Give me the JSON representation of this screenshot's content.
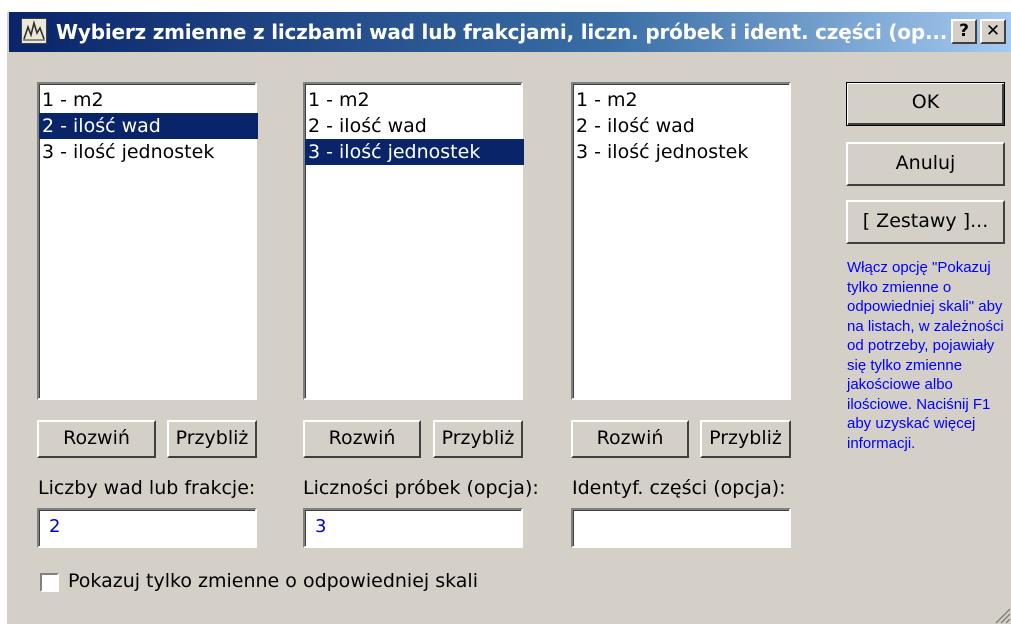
{
  "window": {
    "title": "Wybierz zmienne z liczbami wad lub frakcjami, liczn. próbek i ident. części (op...",
    "help_glyph": "?",
    "close_glyph": "✕"
  },
  "lists": [
    {
      "items": [
        "1 - m2",
        "2 - ilość wad",
        "3 - ilość jednostek"
      ],
      "selected": 1
    },
    {
      "items": [
        "1 - m2",
        "2 - ilość wad",
        "3 - ilość jednostek"
      ],
      "selected": 2
    },
    {
      "items": [
        "1 - m2",
        "2 - ilość wad",
        "3 - ilość jednostek"
      ],
      "selected": -1
    }
  ],
  "list_buttons": {
    "expand": "Rozwiń",
    "zoom": "Przybliż"
  },
  "fields": [
    {
      "label": "Liczby wad lub frakcje:",
      "value": "2"
    },
    {
      "label": "Liczności próbek (opcja):",
      "value": "3"
    },
    {
      "label": "Identyf. części (opcja):",
      "value": ""
    }
  ],
  "actions": {
    "ok": "OK",
    "cancel": "Anuluj",
    "sets": "[ Zestawy ]..."
  },
  "hint": "Włącz opcję \"Pokazuj tylko zmienne o odpowiedniej skali\" aby na listach, w zależności od potrzeby, pojawiały się tylko zmienne jakościowe albo ilościowe. Naciśnij F1 aby uzyskać więcej informacji.",
  "checkbox": {
    "label": "Pokazuj tylko zmienne o odpowiedniej skali",
    "checked": false
  },
  "colors": {
    "selection": "#0a246a",
    "hint_text": "#0000ff",
    "field_value": "#0000cc",
    "dialog_bg": "#d4d0c8"
  }
}
